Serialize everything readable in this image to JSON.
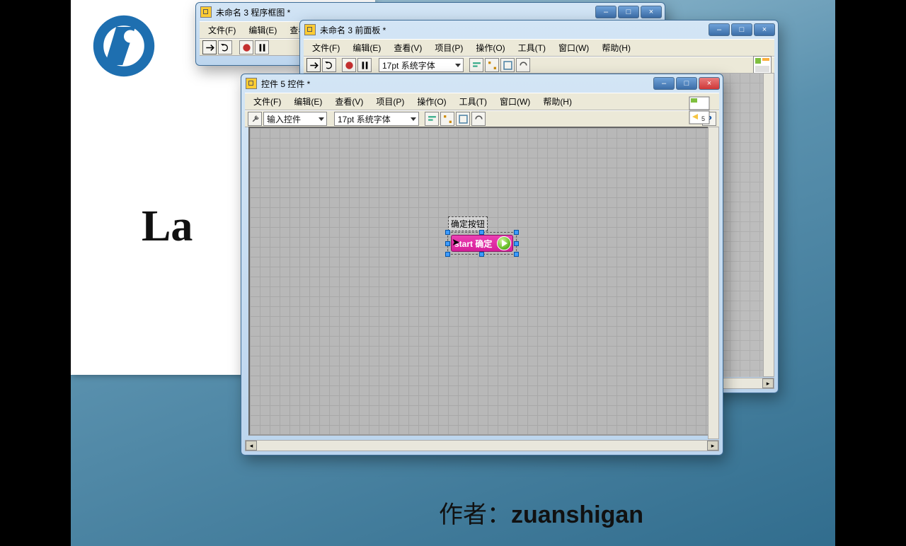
{
  "background": {
    "partial_text": "La",
    "author_label": "作者：",
    "author_name": "zuanshigan"
  },
  "window1": {
    "title": "未命名 3 程序框图 *",
    "menus": {
      "file": "文件(F)",
      "edit": "编辑(E)",
      "view": "查看"
    }
  },
  "window2": {
    "title": "未命名 3 前面板 *",
    "menus": {
      "file": "文件(F)",
      "edit": "编辑(E)",
      "view": "查看(V)",
      "project": "项目(P)",
      "operate": "操作(O)",
      "tools": "工具(T)",
      "window": "窗口(W)",
      "help": "帮助(H)"
    },
    "toolbar": {
      "font_dropdown": "17pt 系统字体"
    }
  },
  "window3": {
    "title": "控件 5 控件 *",
    "menus": {
      "file": "文件(F)",
      "edit": "编辑(E)",
      "view": "查看(V)",
      "project": "项目(P)",
      "operate": "操作(O)",
      "tools": "工具(T)",
      "window": "窗口(W)",
      "help": "帮助(H)"
    },
    "toolbar": {
      "mode_dropdown": "输入控件",
      "font_dropdown": "17pt 系统字体",
      "help": "?"
    },
    "control": {
      "label": "确定按钮",
      "button_text": "start 确定"
    }
  },
  "icons": {
    "min": "–",
    "max": "□",
    "close": "×"
  }
}
